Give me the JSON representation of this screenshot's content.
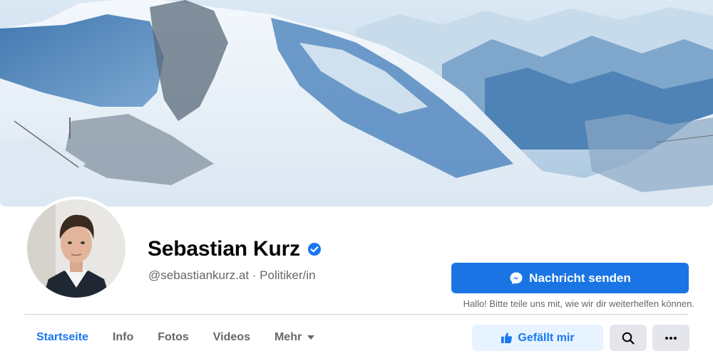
{
  "profile": {
    "name": "Sebastian Kurz",
    "handle": "@sebastiankurz.at · Politiker/in"
  },
  "actions": {
    "message_label": "Nachricht senden",
    "message_note": "Hallo! Bitte teile uns mit, wie wir dir weiterhelfen können.",
    "like_label": "Gefällt mir"
  },
  "tabs": [
    {
      "label": "Startseite",
      "active": true
    },
    {
      "label": "Info"
    },
    {
      "label": "Fotos"
    },
    {
      "label": "Videos"
    },
    {
      "label": "Mehr"
    }
  ],
  "icons": {
    "verified": "verified-badge-icon",
    "messenger": "messenger-icon",
    "like": "thumbs-up-icon",
    "search": "search-icon",
    "more": "more-horizontal-icon"
  },
  "colors": {
    "primary": "#1b74e4",
    "link": "#1877f2",
    "secondary_text": "#65676b",
    "button_grey": "#e4e6eb",
    "like_bg": "#e7f3ff"
  }
}
